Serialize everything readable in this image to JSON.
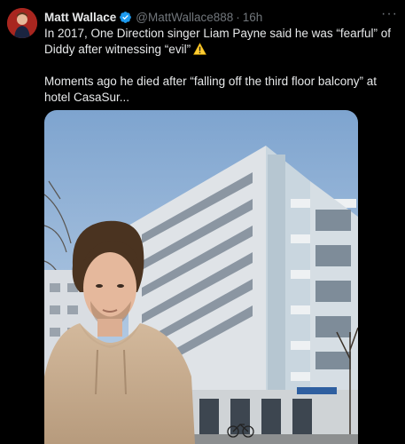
{
  "tweet": {
    "author_name": "Matt Wallace",
    "handle": "@MattWallace888",
    "separator": "·",
    "timestamp": "16h",
    "paragraph_1": "In 2017, One Direction singer Liam Payne said he was “fearful” of Diddy after witnessing “evil”",
    "paragraph_2": "Moments ago he died after “falling off the third floor balcony” at hotel CasaSur...",
    "more_icon": "more-horizontal-icon",
    "verified_icon": "verified-badge-icon",
    "warning_icon": "warning-sign-emoji"
  },
  "colors": {
    "background": "#000000",
    "text_primary": "#e7e9ea",
    "text_secondary": "#71767b",
    "verified": "#1d9bf0",
    "warning": "#ffcc33"
  }
}
